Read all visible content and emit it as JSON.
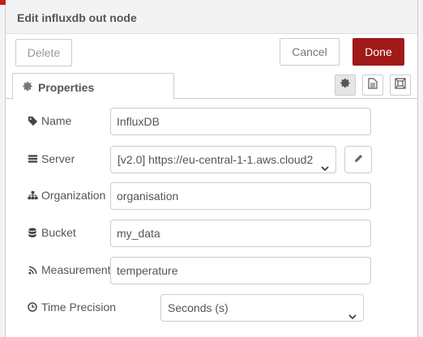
{
  "dialog": {
    "title": "Edit influxdb out node",
    "delete_label": "Delete",
    "cancel_label": "Cancel",
    "done_label": "Done",
    "accent_color": "#a01a1a"
  },
  "tabs": {
    "properties_label": "Properties",
    "icons": [
      "gear-icon",
      "description-icon",
      "appearance-icon"
    ]
  },
  "form": {
    "name": {
      "label": "Name",
      "value": "InfluxDB",
      "icon": "tag-icon"
    },
    "server": {
      "label": "Server",
      "value": "[v2.0] https://eu-central-1-1.aws.cloud2",
      "icon": "server-icon"
    },
    "organization": {
      "label": "Organization",
      "value": "organisation",
      "icon": "sitemap-icon"
    },
    "bucket": {
      "label": "Bucket",
      "value": "my_data",
      "icon": "database-icon"
    },
    "measurement": {
      "label": "Measurement",
      "value": "temperature",
      "icon": "rss-icon"
    },
    "time_precision": {
      "label": "Time Precision",
      "value": "Seconds (s)",
      "icon": "clock-icon"
    }
  }
}
